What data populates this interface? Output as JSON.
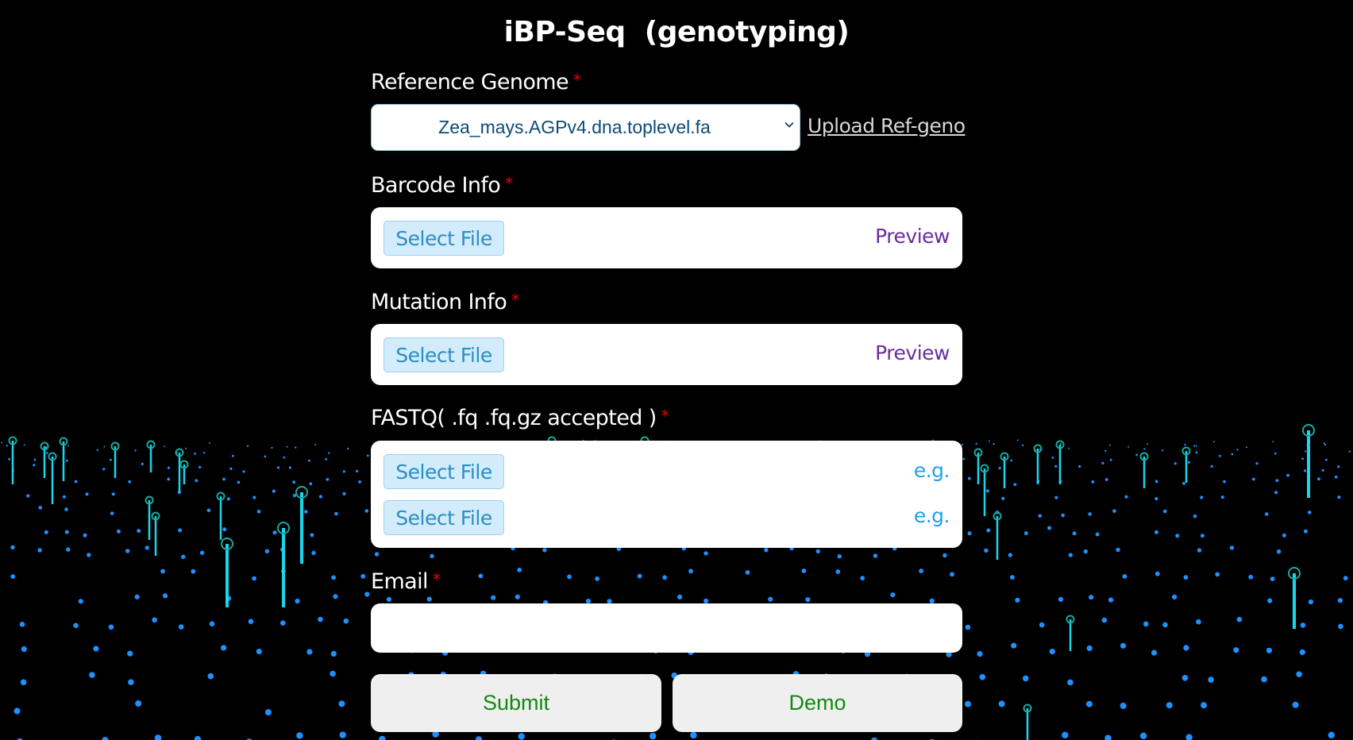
{
  "page": {
    "title": "iBP-Seq  (genotyping)"
  },
  "form": {
    "reference": {
      "label": "Reference Genome",
      "required_mark": "*",
      "selected_option": "Zea_mays.AGPv4.dna.toplevel.fa",
      "upload_link": "Upload Ref-geno"
    },
    "barcode": {
      "label": "Barcode Info",
      "required_mark": "*",
      "select_button": "Select File",
      "preview_link": "Preview"
    },
    "mutation": {
      "label": "Mutation Info",
      "required_mark": "*",
      "select_button": "Select File",
      "preview_link": "Preview"
    },
    "fastq": {
      "label": "FASTQ( .fq .fq.gz accepted )",
      "required_mark": "*",
      "files": [
        {
          "select_button": "Select File",
          "example_link": "e.g."
        },
        {
          "select_button": "Select File",
          "example_link": "e.g."
        }
      ]
    },
    "email": {
      "label": "Email",
      "required_mark": "*",
      "value": "",
      "placeholder": ""
    },
    "actions": {
      "submit_label": "Submit",
      "demo_label": "Demo"
    }
  },
  "colors": {
    "background": "#000000",
    "required": "#ee0000",
    "select_button_bg": "#d3ecfb",
    "select_button_text": "#2a8ec6",
    "preview_link": "#6a2c9a",
    "example_link": "#1ea3e8",
    "action_text": "#128a12",
    "particle_dot": "#1e90ff",
    "particle_pin": "#1ad6ec"
  }
}
